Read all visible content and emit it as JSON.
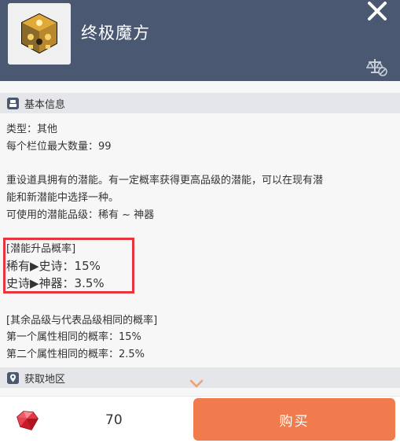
{
  "header": {
    "title": "终极魔方",
    "item_icon": "cube-icon",
    "close_icon": "close-icon",
    "compare_icon": "compare-icon"
  },
  "basic_info": {
    "section_label": "基本信息",
    "type_line": "类型：其他",
    "max_stack_line": "每个栏位最大数量：99"
  },
  "description": {
    "line1": "重设道具拥有的潜能。有一定概率获得更高品级的潜能，可以在现有潜",
    "line2": "能和新潜能中选择一种。",
    "line3": "可使用的潜能品级：稀有 ~ 神器"
  },
  "upgrade_rates": {
    "heading": "[潜能升品概率]",
    "rare_to_epic": "稀有▶史诗：15%",
    "epic_to_legend": "史诗▶神器：3.5%"
  },
  "same_tier_rates": {
    "heading": "[其余品级与代表品级相同的概率]",
    "first": "第一个属性相同的概率：15%",
    "second": "第二个属性相同的概率：2.5%"
  },
  "obtain": {
    "section_label": "获取地区"
  },
  "footer": {
    "currency_icon": "red-crystal-icon",
    "price": "70",
    "buy_label": "购买"
  },
  "colors": {
    "header_bg": "#4b5872",
    "buy_button": "#f07b4d",
    "highlight_border": "#e8343c",
    "chevron": "#f0a070"
  }
}
